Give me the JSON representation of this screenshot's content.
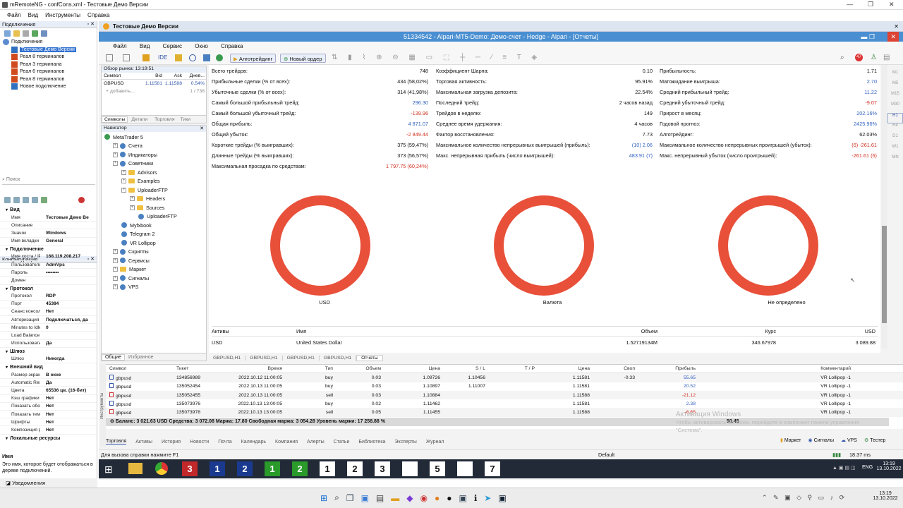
{
  "app": {
    "title": "mRemoteNG - confCons.xml - Тестовые Демо Версии",
    "menu": [
      "Файл",
      "Вид",
      "Инструменты",
      "Справка"
    ]
  },
  "connections": {
    "header": "Подключения",
    "items": [
      "Подключения",
      "Тестовые Демо Версии",
      "Реал 8 терминалов",
      "Реал 3 терминала",
      "Реал 6 терминалов",
      "Реал 8 терминалов",
      "Новое подключение"
    ],
    "search": "Поиск"
  },
  "config": {
    "header": "Конфигурация",
    "sections": [
      {
        "name": "Вид",
        "props": [
          [
            "Имя",
            "Тестовые Демо Ве"
          ],
          [
            "Описание",
            ""
          ],
          [
            "Значок",
            "Windows"
          ],
          [
            "Имя вкладки",
            "General"
          ]
        ]
      },
      {
        "name": "Подключение",
        "props": [
          [
            "Имя хоста / IP",
            "168.119.208.217"
          ],
          [
            "Пользователь",
            "AdmVps"
          ],
          [
            "Пароль",
            "••••••••"
          ],
          [
            "Домен",
            ""
          ]
        ]
      },
      {
        "name": "Протокол",
        "props": [
          [
            "Протокол",
            "RDP"
          ],
          [
            "Порт",
            "45384"
          ],
          [
            "Сеанс консоли",
            "Нет"
          ],
          [
            "Авторизация",
            "Подключаться, да"
          ],
          [
            "Minutes to Idle",
            "0"
          ],
          [
            "Load Balance Ir",
            ""
          ],
          [
            "Использовать",
            "Да"
          ]
        ]
      },
      {
        "name": "Шлюз",
        "props": [
          [
            "Шлюз",
            "Никогда"
          ]
        ]
      },
      {
        "name": "Внешний вид",
        "props": [
          [
            "Размер экрана",
            "В окне"
          ],
          [
            "Automatic Resi",
            "Да"
          ],
          [
            "Цвета",
            "65536 цв. (16-бит)"
          ],
          [
            "Кэш графики",
            "Нет"
          ],
          [
            "Показать обои",
            "Нет"
          ],
          [
            "Показать тем",
            "Нет"
          ],
          [
            "Шрифты",
            "Нет"
          ],
          [
            "Композиция р",
            "Нет"
          ]
        ]
      },
      {
        "name": "Локальные ресурсы",
        "props": []
      }
    ],
    "help_title": "Имя",
    "help_text": "Это имя, которое будет отображаться в дереве подключений."
  },
  "notifications": "Уведомления",
  "mt5": {
    "tab_title": "Тестовые Демо Версии",
    "window_title": "51334542 - Alpari-MT5-Demo: Демо-счет - Hedge - Alpari - [Отчеты]",
    "menu": [
      "Файл",
      "Вид",
      "Сервис",
      "Окно",
      "Справка"
    ],
    "toolbar": {
      "algo": "Алготрейдинг",
      "new_order": "Новый ордер",
      "ide": "IDE"
    },
    "market": {
      "header": "Обзор рынка: 13:19:51",
      "cols": [
        "Символ",
        "Bid",
        "Ask",
        "Днев..."
      ],
      "row": [
        "GBPUSD",
        "1.11581",
        "1.11588",
        "0.54%"
      ],
      "add": "+ добавить...",
      "count": "1 / 738",
      "tabs": [
        "Символы",
        "Детали",
        "Торговля",
        "Тики"
      ]
    },
    "navigator": {
      "header": "Навигатор",
      "items": [
        {
          "label": "MetaTrader 5",
          "lvl": 0,
          "kind": "root"
        },
        {
          "label": "Счета",
          "lvl": 1,
          "kind": "blue"
        },
        {
          "label": "Индикаторы",
          "lvl": 1,
          "kind": "blue"
        },
        {
          "label": "Советники",
          "lvl": 1,
          "kind": "blue"
        },
        {
          "label": "Advisors",
          "lvl": 2,
          "kind": "folder"
        },
        {
          "label": "Examples",
          "lvl": 2,
          "kind": "folder"
        },
        {
          "label": "UploaderFTP",
          "lvl": 2,
          "kind": "folder"
        },
        {
          "label": "Headers",
          "lvl": 3,
          "kind": "folder"
        },
        {
          "label": "Sources",
          "lvl": 3,
          "kind": "folder"
        },
        {
          "label": "UploaderFTP",
          "lvl": 4,
          "kind": "ea"
        },
        {
          "label": "Myfxbook",
          "lvl": 2,
          "kind": "ea"
        },
        {
          "label": "Telegram 2",
          "lvl": 2,
          "kind": "ea"
        },
        {
          "label": "VR Lollipop",
          "lvl": 2,
          "kind": "ea"
        },
        {
          "label": "Скрипты",
          "lvl": 1,
          "kind": "blue"
        },
        {
          "label": "Сервисы",
          "lvl": 1,
          "kind": "blue"
        },
        {
          "label": "Маркет",
          "lvl": 1,
          "kind": "folder"
        },
        {
          "label": "Сигналы",
          "lvl": 1,
          "kind": "blue"
        },
        {
          "label": "VPS",
          "lvl": 1,
          "kind": "blue"
        }
      ],
      "tabs": [
        "Общие",
        "Избранное"
      ]
    },
    "stats": {
      "col1": [
        [
          "Всего трейдов:",
          "748",
          ""
        ],
        [
          "Прибыльные сделки (% от всех):",
          "434 (58,02%)",
          ""
        ],
        [
          "Убыточные сделки (% от всех):",
          "314 (41,98%)",
          ""
        ],
        [
          "Самый большой прибыльный трейд:",
          "296.30",
          "blue"
        ],
        [
          "Самый большой убыточный трейд:",
          "-139.96",
          "red"
        ],
        [
          "Общая прибыль:",
          "4 871.07",
          "blue"
        ],
        [
          "Общий убыток:",
          "-2 849.44",
          "red"
        ],
        [
          "Короткие трейды (% выигравших):",
          "375 (59,47%)",
          ""
        ],
        [
          "Длинные трейды (% выигравших):",
          "373 (56,57%)",
          ""
        ],
        [
          "Максимальная просадка по средствам:",
          "1 797.75 (60,24%)",
          "red"
        ]
      ],
      "col2": [
        [
          "Коэффициент Шарпа:",
          "0.10",
          ""
        ],
        [
          "Торговая активность:",
          "95.91%",
          ""
        ],
        [
          "Максимальная загрузка депозита:",
          "22.54%",
          ""
        ],
        [
          "Последний трейд:",
          "2 часов назад",
          ""
        ],
        [
          "Трейдов в неделю:",
          "149",
          ""
        ],
        [
          "Среднее время удержания:",
          "4 часов",
          ""
        ],
        [
          "Фактор восстановления:",
          "7.73",
          ""
        ],
        [
          "Максимальное количество непрерывных выигрышей (прибыль):",
          "(10) 2.06",
          "blue"
        ],
        [
          "Макс. непрерывная прибыль (число выигрышей):",
          "483.91 (7)",
          "blue"
        ]
      ],
      "col3": [
        [
          "Прибыльность:",
          "1.71",
          ""
        ],
        [
          "Матожидание выигрыша:",
          "2.70",
          "blue"
        ],
        [
          "Средний прибыльный трейд:",
          "11.22",
          "blue"
        ],
        [
          "Средний убыточный трейд:",
          "-9.07",
          "red"
        ],
        [
          "Прирост в месяц:",
          "202.16%",
          "blue"
        ],
        [
          "Годовой прогноз:",
          "2425.96%",
          "blue"
        ],
        [
          "Алготрейдинг:",
          "62.03%",
          ""
        ],
        [
          "Максимальное количество непрерывных проигрышей (убыток):",
          "(6) -261.61",
          "red"
        ],
        [
          "Макс. непрерывный убыток (число проигрышей):",
          "-261.61 (6)",
          "red"
        ]
      ]
    },
    "rings": [
      "USD",
      "Валюта",
      "Не определено"
    ],
    "assets": {
      "cols": [
        "Активы",
        "Имя",
        "Объем",
        "Курс",
        "USD"
      ],
      "row": [
        "USD",
        "United States Dollar",
        "1.52719134M",
        "346.67978",
        "3 089.88"
      ]
    },
    "chart_tabs": [
      "GBPUSD,H1",
      "GBPUSD,H1",
      "GBPUSD,H1",
      "GBPUSD,H1",
      "Отчеты"
    ],
    "trades": {
      "cols": [
        "Символ",
        "Тикет",
        "Время",
        "Тип",
        "Объем",
        "Цена",
        "S / L",
        "T / P",
        "Цена",
        "Своп",
        "Прибыль",
        "Комментарий"
      ],
      "rows": [
        [
          "gbpusd",
          "134856989",
          "2022.10.12 11:00:05",
          "buy",
          "0.03",
          "1.09726",
          "1.10456",
          "",
          "1.11581",
          "-0.33",
          "55.65",
          "VR Lollipop -1"
        ],
        [
          "gbpusd",
          "135052454",
          "2022.10.13 11:00:05",
          "buy",
          "0.03",
          "1.10897",
          "1.11007",
          "",
          "1.11581",
          "",
          "20.52",
          "VR Lollipop -1"
        ],
        [
          "gbpusd",
          "135052455",
          "2022.10.13 11:00:05",
          "sell",
          "0.03",
          "1.10884",
          "",
          "",
          "1.11588",
          "",
          "-21.12",
          "VR Lollipop -1"
        ],
        [
          "gbpusd",
          "135073976",
          "2022.10.13 13:00:05",
          "buy",
          "0.02",
          "1.11462",
          "",
          "",
          "1.11581",
          "",
          "2.38",
          "VR Lollipop -1"
        ],
        [
          "gbpusd",
          "135073978",
          "2022.10.13 13:00:05",
          "sell",
          "0.05",
          "1.11455",
          "",
          "",
          "1.11588",
          "",
          "-6.65",
          "VR Lollipop -1"
        ]
      ],
      "balance": "Баланс: 3 021.63 USD  Средства: 3 072.08  Маржа: 17.80  Свободная маржа: 3 054.28  Уровень маржи: 17 258.88 %",
      "total": "50.45"
    },
    "bottom_tabs": [
      "Торговля",
      "Активы",
      "История",
      "Новости",
      "Почта",
      "Календарь",
      "Компания",
      "Алерты",
      "Статьи",
      "Библиотека",
      "Эксперты",
      "Журнал"
    ],
    "right_tabs": [
      "Маркет",
      "Сигналы",
      "VPS",
      "Тестер"
    ],
    "side_label": "Инструменты",
    "status": {
      "help": "Для вызова справки нажмите F1",
      "profile": "Default",
      "ping": "18.37 ms"
    },
    "activation": {
      "title": "Активация Windows",
      "text": "Чтобы активировать Windows, перейдите в компонент панели управления \"Система\"."
    },
    "timeframes": [
      "M1",
      "M5",
      "M15",
      "M30",
      "H1",
      "H4",
      "D1",
      "W1",
      "MN"
    ]
  },
  "remote_taskbar": {
    "buttons": [
      "3",
      "1",
      "2",
      "1",
      "2",
      "1",
      "2",
      "3",
      "",
      "5",
      "",
      "7"
    ],
    "lang": "ENG",
    "time": "13:19",
    "date": "13.10.2022"
  },
  "windows_taskbar": {
    "time": "13:19",
    "date": "13.10.2022"
  }
}
